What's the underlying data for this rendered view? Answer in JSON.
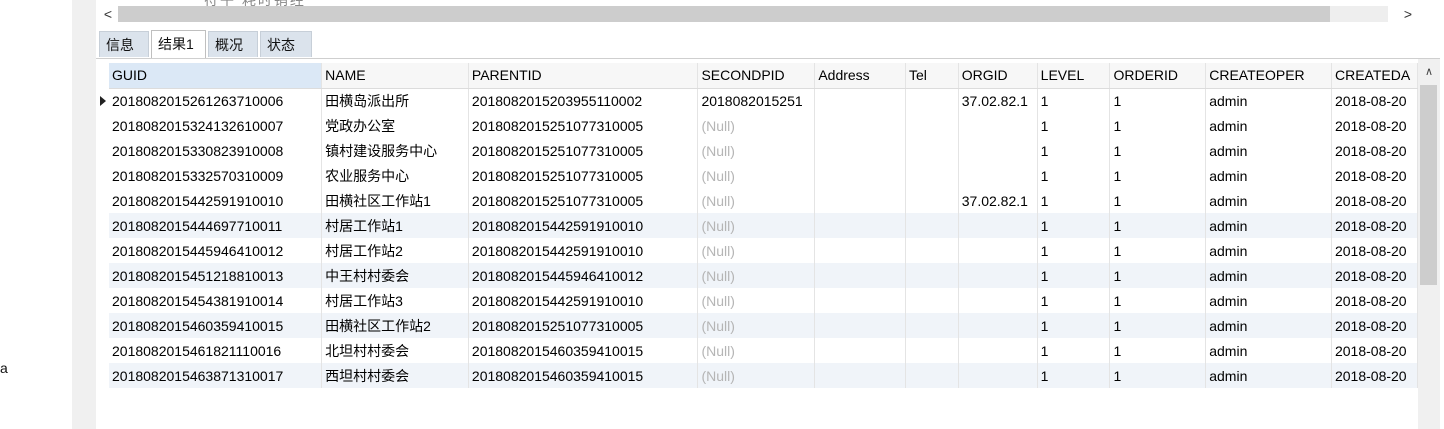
{
  "left_panel": {
    "cut_text": "a"
  },
  "top_strip": {
    "cut_text": "符午    耗时销经"
  },
  "scrollbars": {
    "left_arrow": "<",
    "right_arrow": ">",
    "up_arrow": "∧"
  },
  "tabs": [
    {
      "label": "信息",
      "active": false
    },
    {
      "label": "结果1",
      "active": true
    },
    {
      "label": "概况",
      "active": false
    },
    {
      "label": "状态",
      "active": false
    }
  ],
  "grid": {
    "columns": [
      "GUID",
      "NAME",
      "PARENTID",
      "SECONDPID",
      "Address",
      "Tel",
      "ORGID",
      "LEVEL",
      "ORDERID",
      "CREATEOPER",
      "CREATEDA"
    ],
    "rows": [
      [
        "20180820152612637100​06",
        "田横岛派出所",
        "20180820152039551100​02",
        "2018082015251",
        "",
        "",
        "37.02.82.1",
        "1",
        "1",
        "admin",
        "2018-08-20"
      ],
      [
        "20180820153241326100​07",
        "党政办公室",
        "20180820152510773100​05",
        "(Null)",
        "",
        "",
        "",
        "1",
        "1",
        "admin",
        "2018-08-20"
      ],
      [
        "20180820153308239100​08",
        "镇村建设服务中心",
        "20180820152510773100​05",
        "(Null)",
        "",
        "",
        "",
        "1",
        "1",
        "admin",
        "2018-08-20"
      ],
      [
        "20180820153325703100​09",
        "农业服务中心",
        "20180820152510773100​05",
        "(Null)",
        "",
        "",
        "",
        "1",
        "1",
        "admin",
        "2018-08-20"
      ],
      [
        "20180820154425919100​10",
        "田横社区工作站1",
        "20180820152510773100​05",
        "(Null)",
        "",
        "",
        "37.02.82.1",
        "1",
        "1",
        "admin",
        "2018-08-20"
      ],
      [
        "20180820154446977100​11",
        "村居工作站1",
        "20180820154425919100​10",
        "(Null)",
        "",
        "",
        "",
        "1",
        "1",
        "admin",
        "2018-08-20"
      ],
      [
        "20180820154459464100​12",
        "村居工作站2",
        "20180820154425919100​10",
        "(Null)",
        "",
        "",
        "",
        "1",
        "1",
        "admin",
        "2018-08-20"
      ],
      [
        "20180820154512188100​13",
        "中王村村委会",
        "20180820154459464100​12",
        "(Null)",
        "",
        "",
        "",
        "1",
        "1",
        "admin",
        "2018-08-20"
      ],
      [
        "20180820154543819100​14",
        "村居工作站3",
        "20180820154425919100​10",
        "(Null)",
        "",
        "",
        "",
        "1",
        "1",
        "admin",
        "2018-08-20"
      ],
      [
        "20180820154603594100​15",
        "田横社区工作站2",
        "20180820152510773100​05",
        "(Null)",
        "",
        "",
        "",
        "1",
        "1",
        "admin",
        "2018-08-20"
      ],
      [
        "20180820154618211100​16",
        "北坦村村委会",
        "20180820154603594100​15",
        "(Null)",
        "",
        "",
        "",
        "1",
        "1",
        "admin",
        "2018-08-20"
      ],
      [
        "20180820154638713100​17",
        "西坦村村委会",
        "20180820154603594100​15",
        "(Null)",
        "",
        "",
        "",
        "1",
        "1",
        "admin",
        "2018-08-20"
      ]
    ]
  }
}
